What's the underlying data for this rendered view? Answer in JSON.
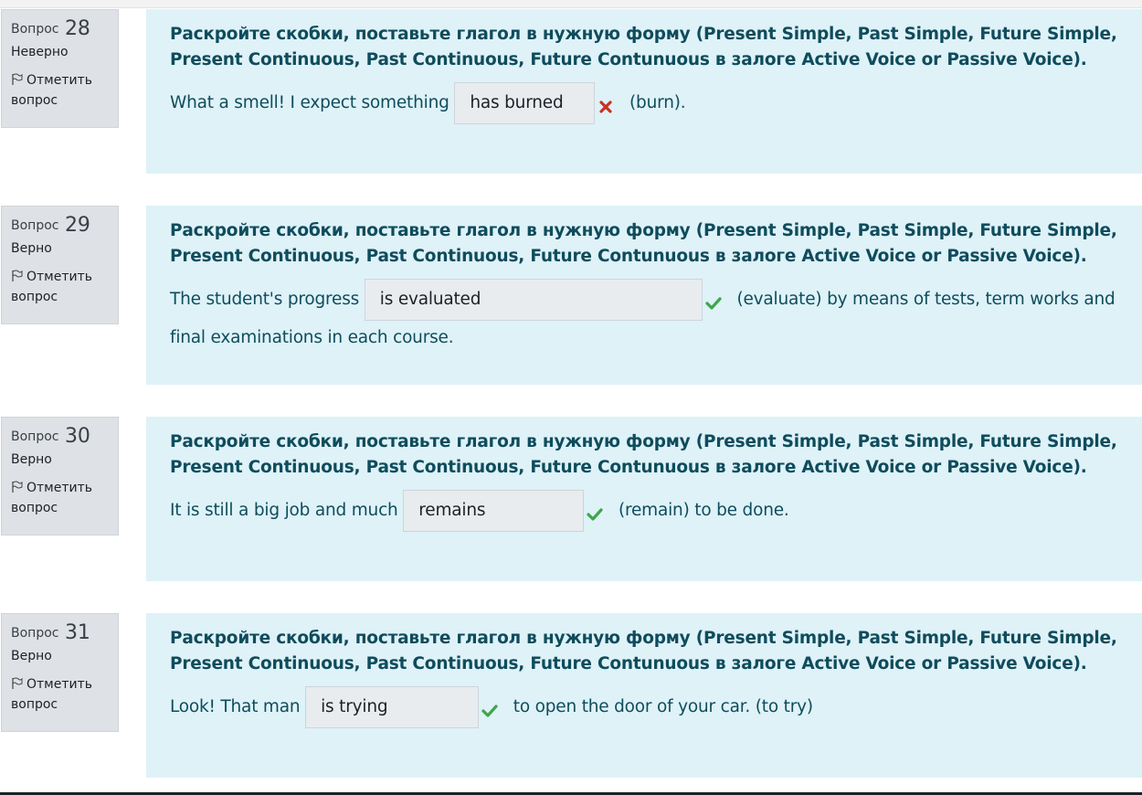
{
  "questions": [
    {
      "word": "Вопрос",
      "number": "28",
      "state": "Неверно",
      "flag_label": "Отметить вопрос",
      "text": "Раскройте скобки, поставьте глагол в нужную форму (Present Simple, Past Simple, Future Simple, Present Continuous, Past Continuous, Future Contunuous в залоге Active Voice or Passive Voice).",
      "before": "What a smell! I expect something",
      "answer": "has burned",
      "result_icon": "cross-icon",
      "after": "(burn)."
    },
    {
      "word": "Вопрос",
      "number": "29",
      "state": "Верно",
      "flag_label": "Отметить вопрос",
      "text": "Раскройте скобки, поставьте глагол в нужную форму (Present Simple, Past Simple, Future Simple, Present Continuous, Past Continuous, Future Contunuous в залоге Active Voice or Passive Voice).",
      "before": "The student's progress",
      "answer": "is evaluated",
      "result_icon": "check-icon",
      "after": "(evaluate)  by means of tests, term works and final examinations in each course."
    },
    {
      "word": "Вопрос",
      "number": "30",
      "state": "Верно",
      "flag_label": "Отметить вопрос",
      "text": "Раскройте скобки, поставьте глагол в нужную форму (Present Simple, Past Simple, Future Simple, Present Continuous, Past Continuous, Future Contunuous в залоге Active Voice or Passive Voice).",
      "before": "It is still a big job and much",
      "answer": "remains",
      "result_icon": "check-icon",
      "after": "(remain)  to be done."
    },
    {
      "word": "Вопрос",
      "number": "31",
      "state": "Верно",
      "flag_label": "Отметить вопрос",
      "text": "Раскройте скобки, поставьте глагол в нужную форму (Present Simple, Past Simple, Future Simple, Present Continuous, Past Continuous, Future Contunuous в залоге Active Voice or Passive Voice).",
      "before": "Look! That man",
      "answer": "is trying",
      "result_icon": "check-icon",
      "after": "to open the door of your car. (to try)"
    }
  ],
  "colors": {
    "info_bg": "#dee2e6",
    "content_bg": "#def2f8",
    "text": "#0f4c5c",
    "correct": "#3fa648",
    "incorrect": "#ca3120"
  }
}
